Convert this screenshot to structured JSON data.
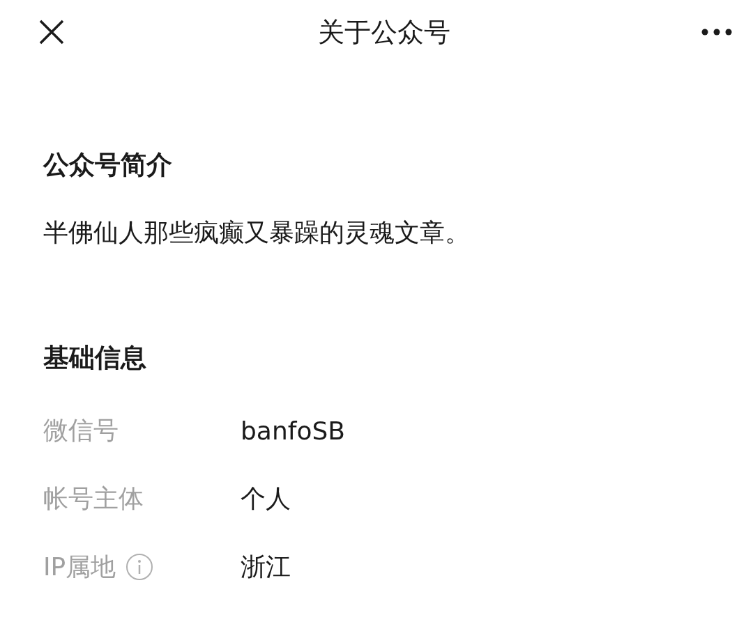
{
  "header": {
    "title": "关于公众号"
  },
  "intro": {
    "heading": "公众号简介",
    "text": "半佛仙人那些疯癫又暴躁的灵魂文章。"
  },
  "basic_info": {
    "heading": "基础信息",
    "rows": [
      {
        "label": "微信号",
        "value": "banfoSB",
        "info": false
      },
      {
        "label": "帐号主体",
        "value": "个人",
        "info": false
      },
      {
        "label": "IP属地",
        "value": "浙江",
        "info": true
      }
    ]
  }
}
